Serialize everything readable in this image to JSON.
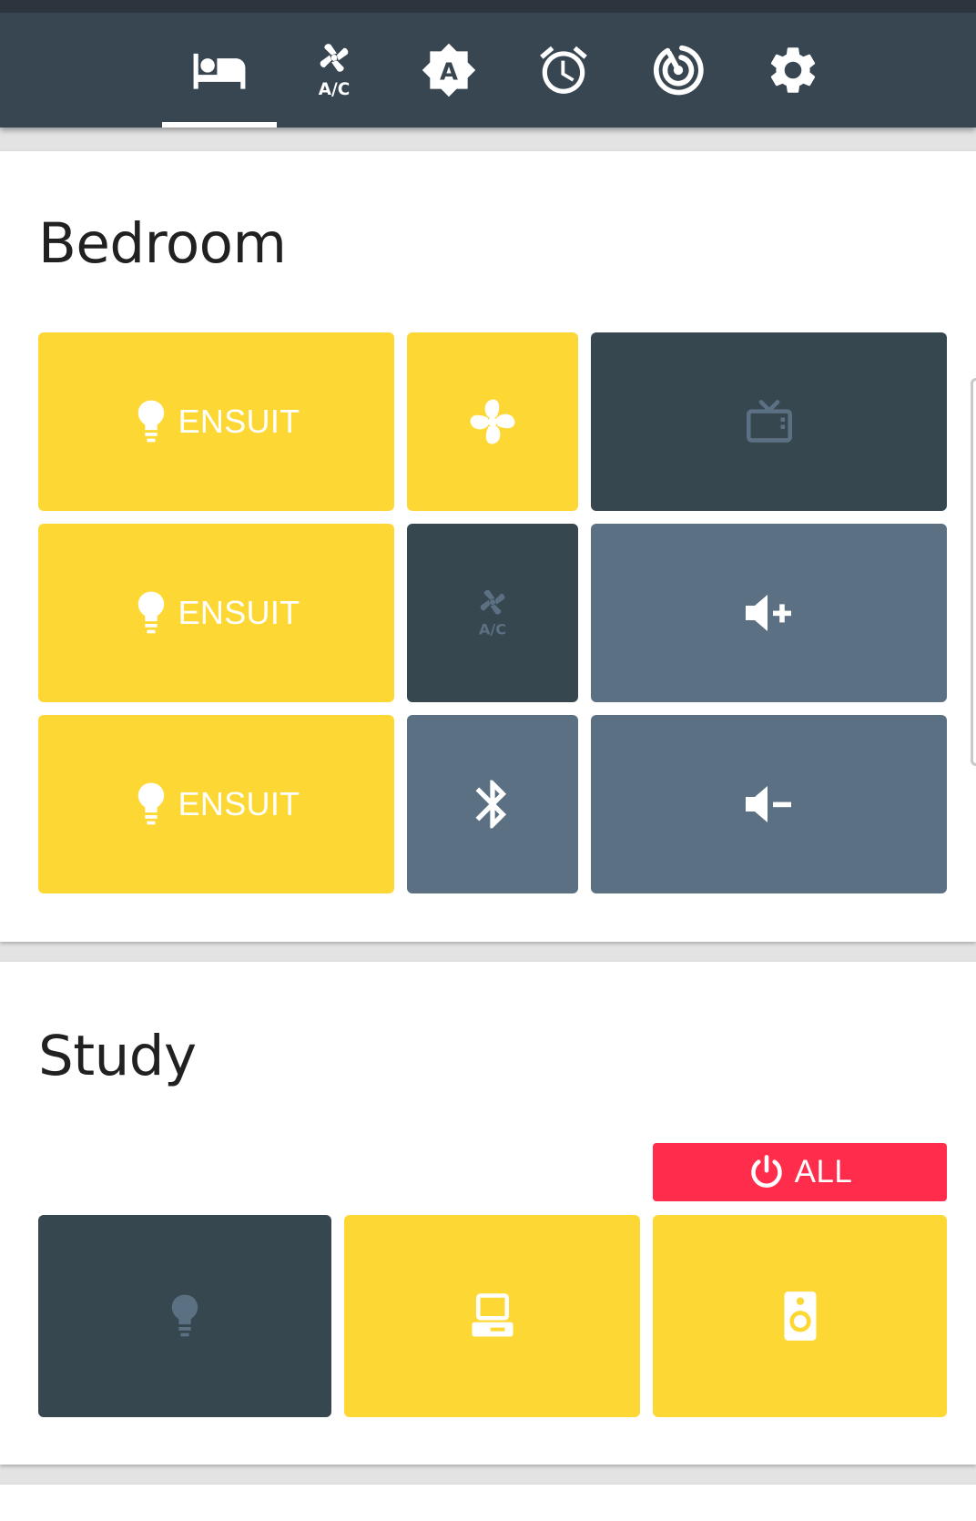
{
  "nav": {
    "tabs": [
      {
        "icon": "bed-icon",
        "selected": true
      },
      {
        "icon": "fan-ac-icon",
        "selected": false
      },
      {
        "icon": "brightness-auto-icon",
        "selected": false
      },
      {
        "icon": "alarm-clock-icon",
        "selected": false
      },
      {
        "icon": "radar-icon",
        "selected": false
      },
      {
        "icon": "gear-icon",
        "selected": false
      }
    ]
  },
  "bedroom": {
    "title": "Bedroom",
    "tiles": {
      "light1": {
        "label": "ENSUIT",
        "icon": "lightbulb-icon",
        "state": "on"
      },
      "light2": {
        "label": "ENSUIT",
        "icon": "lightbulb-icon",
        "state": "on"
      },
      "light3": {
        "label": "ENSUIT",
        "icon": "lightbulb-icon",
        "state": "on"
      },
      "fan": {
        "icon": "fan-icon",
        "state": "on"
      },
      "ac": {
        "icon": "fan-ac-icon",
        "state": "off"
      },
      "bluetooth": {
        "icon": "bluetooth-icon"
      },
      "tv": {
        "icon": "tv-icon",
        "state": "off"
      },
      "volume_up": {
        "icon": "volume-plus-icon"
      },
      "volume_down": {
        "icon": "volume-minus-icon"
      }
    }
  },
  "study": {
    "title": "Study",
    "all_button": {
      "label": "ALL",
      "icon": "power-icon"
    },
    "tiles": {
      "light": {
        "icon": "lightbulb-icon",
        "state": "off"
      },
      "computer": {
        "icon": "computer-icon",
        "state": "on"
      },
      "speaker": {
        "icon": "speaker-icon",
        "state": "on"
      }
    }
  },
  "colors": {
    "header": "#384652",
    "on": "#fdd835",
    "off": "#37474f",
    "action": "#5b7083",
    "power_all": "#ff2d4b",
    "icon_off": "#5b7083"
  }
}
